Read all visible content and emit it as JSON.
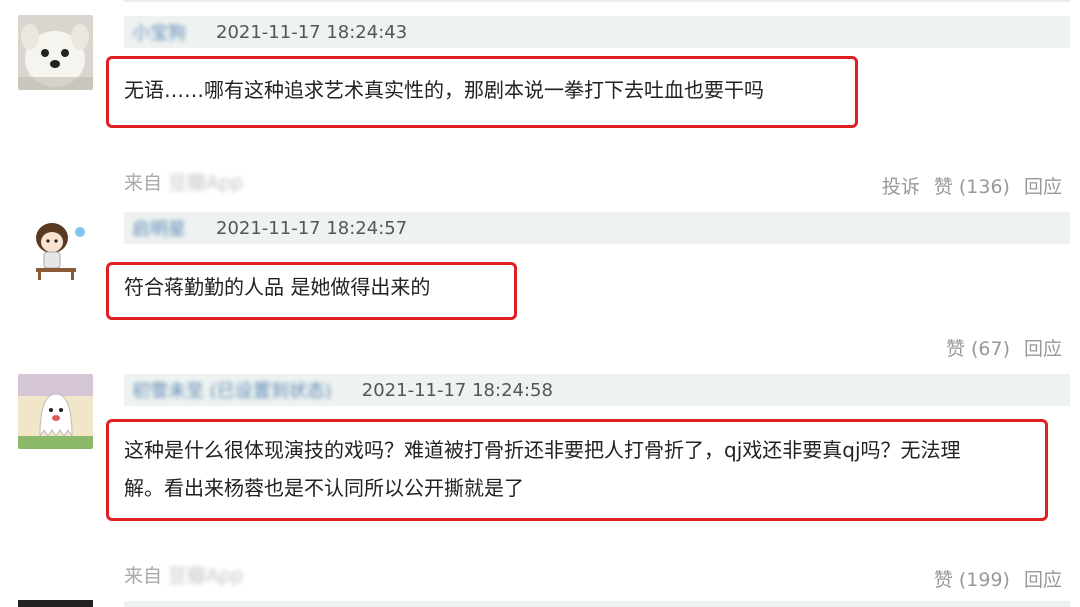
{
  "comments": [
    {
      "username": "小宝狗",
      "time": "2021-11-17 18:24:43",
      "lines": [
        "无语……哪有这种追求艺术真实性的，那剧本说一拳打下去吐血也要干吗"
      ],
      "source": "来自",
      "source_app": "豆瓣App",
      "actions": {
        "report": "投诉",
        "like": "赞 (136)",
        "reply": "回应"
      }
    },
    {
      "username": "启明星",
      "time": "2021-11-17 18:24:57",
      "lines": [
        "符合蒋勤勤的人品 是她做得出来的"
      ],
      "actions": {
        "like": "赞 (67)",
        "reply": "回应"
      }
    },
    {
      "username": "初雪未至 (已设置到状态)",
      "time": "2021-11-17 18:24:58",
      "lines": [
        "这种是什么很体现演技的戏吗？难道被打骨折还非要把人打骨折了，qj戏还非要真qj吗？无法理",
        "解。看出来杨蓉也是不认同所以公开撕就是了"
      ],
      "source": "来自",
      "source_app": "豆瓣App",
      "actions": {
        "like": "赞 (199)",
        "reply": "回应"
      }
    }
  ],
  "colors": {
    "highlight": "#e02020",
    "meta_bg": "#eef3f1",
    "muted": "#999999"
  },
  "icons": [
    "dog-avatar-icon",
    "cartoon-kid-avatar-icon",
    "ghost-avatar-icon"
  ]
}
